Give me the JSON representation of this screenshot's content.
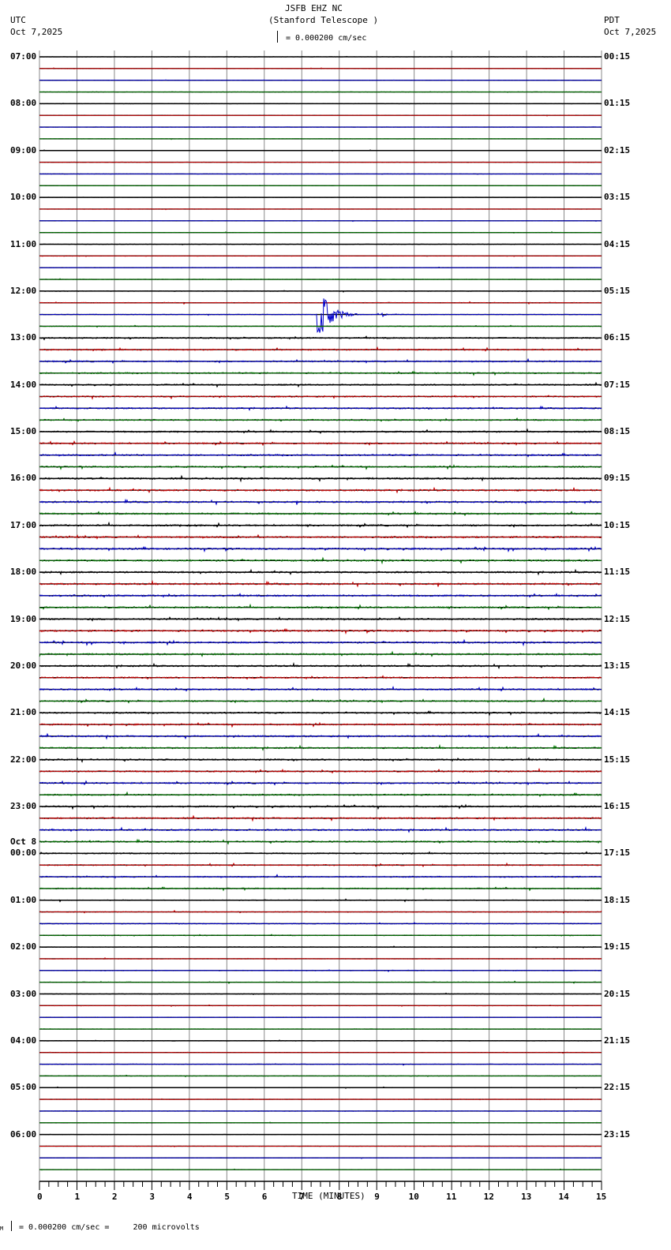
{
  "header": {
    "station": "JSFB EHZ NC",
    "site": "(Stanford Telescope )",
    "left_tz": "UTC",
    "left_date": "Oct 7,2025",
    "right_tz": "PDT",
    "right_date": "Oct 7,2025",
    "scale": "= 0.000200 cm/sec"
  },
  "footer": {
    "scale": "= 0.000200 cm/sec =     200 microvolts",
    "mark": "M"
  },
  "chart_data": {
    "type": "line",
    "title": "JSFB EHZ NC (Stanford Telescope )",
    "xlabel": "TIME (MINUTES)",
    "xlim": [
      0,
      15
    ],
    "x_ticks": [
      "0",
      "1",
      "2",
      "3",
      "4",
      "5",
      "6",
      "7",
      "8",
      "9",
      "10",
      "11",
      "12",
      "13",
      "14",
      "15"
    ],
    "traces_per_hour": 4,
    "trace_colors": [
      "#000000",
      "#cc0000",
      "#0000cc",
      "#007700"
    ],
    "left_labels": [
      "07:00",
      "08:00",
      "09:00",
      "10:00",
      "11:00",
      "12:00",
      "13:00",
      "14:00",
      "15:00",
      "16:00",
      "17:00",
      "18:00",
      "19:00",
      "20:00",
      "21:00",
      "22:00",
      "23:00",
      "00:00",
      "01:00",
      "02:00",
      "03:00",
      "04:00",
      "05:00",
      "06:00"
    ],
    "date_change_label": "Oct 8",
    "right_labels": [
      "00:15",
      "01:15",
      "02:15",
      "03:15",
      "04:15",
      "05:15",
      "06:15",
      "07:15",
      "08:15",
      "09:15",
      "10:15",
      "11:15",
      "12:15",
      "13:15",
      "14:15",
      "15:15",
      "16:15",
      "17:15",
      "18:15",
      "19:15",
      "20:15",
      "21:15",
      "22:15",
      "23:15"
    ],
    "noise_by_hour": [
      0.3,
      0.3,
      0.3,
      0.3,
      0.4,
      0.5,
      1,
      1,
      1.1,
      1.2,
      1.2,
      1.2,
      1.2,
      1.1,
      1.1,
      1.1,
      1.1,
      0.9,
      0.6,
      0.5,
      0.4,
      0.4,
      0.4,
      0.3
    ],
    "events": [
      {
        "trace": 22,
        "minute": 7.4,
        "duration_min": 1.2,
        "amplitude": 1,
        "label": "earthquake"
      },
      {
        "trace": 22,
        "minute": 9.1,
        "duration_min": 0.3,
        "amplitude": 0.15,
        "label": "aftershock"
      }
    ]
  }
}
